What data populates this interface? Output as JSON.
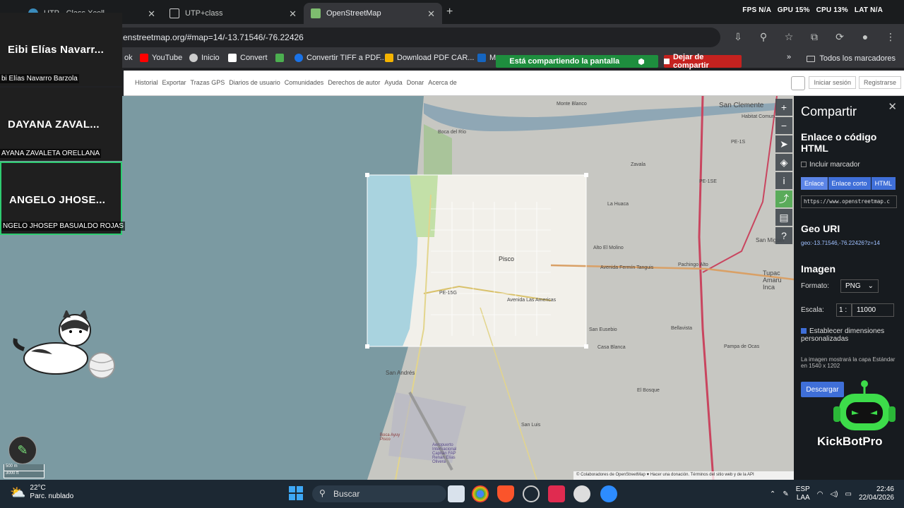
{
  "browser": {
    "tabs": [
      {
        "label": "UTP - Class Xcell...",
        "active": false
      },
      {
        "label": "UTP+class",
        "active": false
      },
      {
        "label": "OpenStreetMap",
        "active": true
      }
    ],
    "stats": {
      "fps": "FPS N/A",
      "gpu": "GPU 15%",
      "cpu": "CPU 13%",
      "lat": "LAT N/A"
    },
    "url": "enstreetmap.org/#map=14/-13.71546/-76.22426",
    "bookmarks": [
      "ok",
      "YouTube",
      "Inicio",
      "Convert",
      "Convertir TIFF a PDF...",
      "Download PDF CAR...",
      "M"
    ],
    "all_bookmarks": "Todos los marcadores"
  },
  "screen_share": {
    "status": "Está compartiendo la pantalla",
    "stop": "Dejar de compartir"
  },
  "osm": {
    "nav_links": [
      "Historial",
      "Exportar",
      "Trazas GPS",
      "Diarios de usuario",
      "Comunidades",
      "Derechos de autor",
      "Ayuda",
      "Donar",
      "Acerca de"
    ],
    "login": "Iniciar sesión",
    "register": "Registrarse",
    "map_labels": {
      "monte_blanco": "Monte Blanco",
      "san_clemente": "San Clemente",
      "habitat": "Habitat Comun...",
      "boca_del_rio": "Boca del Río",
      "zavala": "Zavala",
      "la_huaca": "La Huaca",
      "pisco": "Pisco",
      "alto_molino": "Alto El Molino",
      "pachingo": "Pachingo Alto",
      "tupac_amaru": "Tupac Amaru Inca",
      "san_miguel": "San Miguel",
      "pe15": "PE-1S",
      "pe15e": "PE-1SE",
      "pe15g": "PE-15G",
      "av_las_americas": "Avenida Las Americas",
      "av_fermin": "Avenida Fermín Tanguis",
      "san_andres": "San Andrés",
      "san_eusebio": "San Eusebio",
      "casa_blanca": "Casa Blanca",
      "bellavista": "Bellavista",
      "pampa_ocas": "Pampa de Ocas",
      "el_bosque": "El Bosque",
      "san_luis": "San Luis",
      "aeropuerto": "Aeropuerto Internacional Capitán FAP Renán Elías Olivera",
      "bocas": "Boca Ayuy Pisco"
    },
    "scale": {
      "metric": "500 m",
      "imperial": "3000 ft"
    },
    "attribution": "© Colaboradores de OpenStreetMap ♥ Hacer una donación. Términos del sitio web y de la API",
    "share_panel": {
      "title": "Compartir",
      "link_heading": "Enlace o código HTML",
      "include_marker": "Incluir marcador",
      "tabs": [
        "Enlace",
        "Enlace corto",
        "HTML"
      ],
      "url_value": "https://www.openstreetmap.c",
      "geo_heading": "Geo URI",
      "geo_value": "geo:-13.71546,-76.22426?z=14",
      "image_heading": "Imagen",
      "format_label": "Formato:",
      "format_value": "PNG",
      "scale_label": "Escala:",
      "scale_prefix": "1 :",
      "scale_value": "11000",
      "custom_dims": "Establecer dimensiones personalizadas",
      "info": "La imagen mostrará la capa Estándar en 1540 x 1202",
      "download": "Descargar"
    }
  },
  "meeting": {
    "participants": [
      {
        "tile": "Eibi Elías Navarr...",
        "label": "bi Elías Navarro Barzola",
        "speaking": false
      },
      {
        "tile": "DAYANA ZAVAL...",
        "label": "AYANA ZAVALETA ORELLANA",
        "speaking": false
      },
      {
        "tile": "ANGELO JHOSE...",
        "label": "NGELO JHOSEP BASUALDO ROJAS",
        "speaking": true
      }
    ]
  },
  "overlay": {
    "bot_name": "KickBotPro"
  },
  "taskbar": {
    "temperature": "22°C",
    "weather": "Parc. nublado",
    "search": "Buscar",
    "lang": "ESP",
    "lang2": "LAA",
    "time": "22:46",
    "date": "22/04/2026"
  }
}
